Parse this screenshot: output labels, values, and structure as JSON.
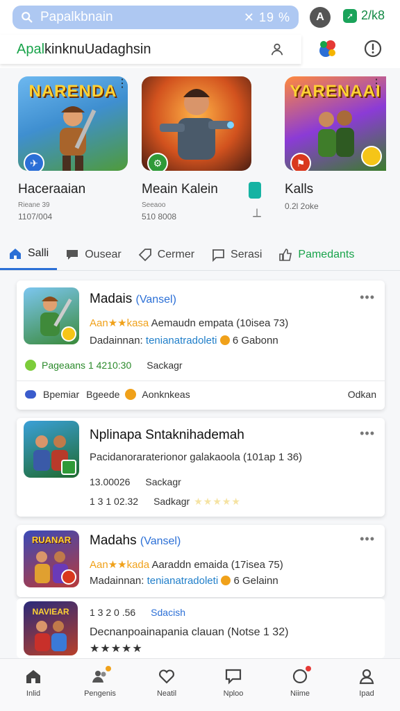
{
  "header": {
    "search_text": "Papalkbnain",
    "search_right": "✕ 19 %",
    "circle_letter": "A",
    "badge_text": "2/k8",
    "subtitle_green": "Apal",
    "subtitle_rest": "kinknuUadaghsin"
  },
  "featured": [
    {
      "art_caption": "NARENDA",
      "name": "Haceraaian",
      "meta1": "Rieane 39",
      "meta2": "1107/004",
      "badge_color": "#2b6fd6",
      "bg": "#3f8fd0"
    },
    {
      "art_caption": "",
      "name": "Meain Kalein",
      "meta1": "Seeaoo",
      "meta2": "510 8008",
      "badge_color": "#2f9a38",
      "bg": "#c0501f"
    },
    {
      "art_caption": "YARENAAI",
      "name": "Kalls",
      "meta1": "",
      "meta2": "0.2l 2oke",
      "badge_color": "#d9381e",
      "bg": "#8b3bd6"
    }
  ],
  "tabs": [
    {
      "label": "Salli",
      "icon": "home-icon"
    },
    {
      "label": "Ousear",
      "icon": "chat-icon"
    },
    {
      "label": "Cermer",
      "icon": "tag-icon"
    },
    {
      "label": "Serasi",
      "icon": "message-icon"
    },
    {
      "label": "Pamedants",
      "icon": "thumb-icon"
    }
  ],
  "cards": [
    {
      "title": "Madais",
      "title_tag": "(Vansel)",
      "line1_orange": "Aan★★kasa",
      "line1_rest": " Aemaudn empata (10isea 73)",
      "line2_dark": "Dadainnan:",
      "line2_blue": " tenianatradoleti",
      "line2_end": " 6 Gabonn",
      "row_a_label": "Pageaans 1 4210:30",
      "row_a_extra": "Sackagr",
      "row_b_a": "Bpemiar",
      "row_b_b": "Bgeede",
      "row_b_c": "Aonknkeas",
      "row_b_right": "Odkan"
    },
    {
      "title": "Nplinapa Sntaknihademah",
      "line1": "Pacidanoraraterionor galakaoola (101ap 1 36)",
      "row1_num": "13.00026",
      "row1_txt": "Sackagr",
      "row2_num": "1 3 1 02.32",
      "row2_txt": "Sadkagr"
    },
    {
      "title": "Madahs",
      "title_tag": "(Vansel)",
      "line1_orange": "Aan★★kada",
      "line1_rest": " Aaraddn emaida (17isea 75)",
      "line2_dark": "Madainnan:",
      "line2_blue": " tenianatradoleti",
      "line2_end": " 6 Gelainn"
    },
    {
      "row1_num": "1 3 2 0 .56",
      "row1_blue": "Sdacish",
      "line1": "Decnanpoainapania clauan (Notse 1 32)",
      "stars": "★★★★★"
    }
  ],
  "bottom_nav": [
    {
      "label": "Inlid",
      "icon": "home-icon"
    },
    {
      "label": "Pengenis",
      "icon": "people-icon"
    },
    {
      "label": "Neatil",
      "icon": "heart-icon"
    },
    {
      "label": "Nploo",
      "icon": "chat-icon"
    },
    {
      "label": "Niime",
      "icon": "bell-icon"
    },
    {
      "label": "Ipad",
      "icon": "user-icon"
    }
  ],
  "colors": {
    "accent": "#2b6fd6",
    "green": "#18a34a",
    "orange": "#f0a11a"
  }
}
